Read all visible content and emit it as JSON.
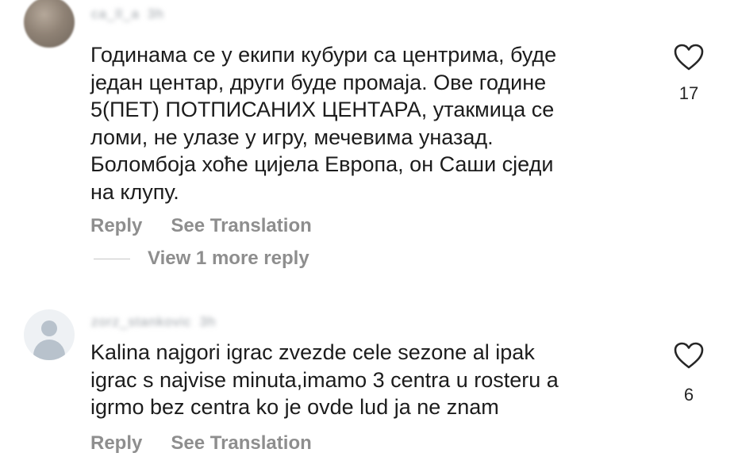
{
  "comments": [
    {
      "username": "ca_ll_a",
      "time": "3h",
      "text": "Годинама се у екипи кубури са центрима, буде\nједан центар, други буде промаја. Ове године\n5(ПЕТ) ПОТПИСАНИХ ЦЕНТАРА, утакмица се\nломи, не улазе у игру, мечевима уназад.\nБоломбоја хоће цијела Европа, он Саши сједи\nна клупу.",
      "likes": "17",
      "reply_label": "Reply",
      "translate_label": "See Translation",
      "more_replies_label": "View 1 more reply"
    },
    {
      "username": "zorz_stankovic",
      "time": "3h",
      "text": "Kalina najgori igrac zvezde cele sezone al ipak\nigrac s najvise minuta,imamo 3 centra u rosteru a\nigrmo bez centra ko je ovde lud ja ne znam",
      "likes": "6",
      "reply_label": "Reply",
      "translate_label": "See Translation"
    }
  ],
  "icons": {
    "like": "heart-outline-icon"
  },
  "colors": {
    "text": "#1c1c1c",
    "secondary": "#8e8e8e"
  }
}
